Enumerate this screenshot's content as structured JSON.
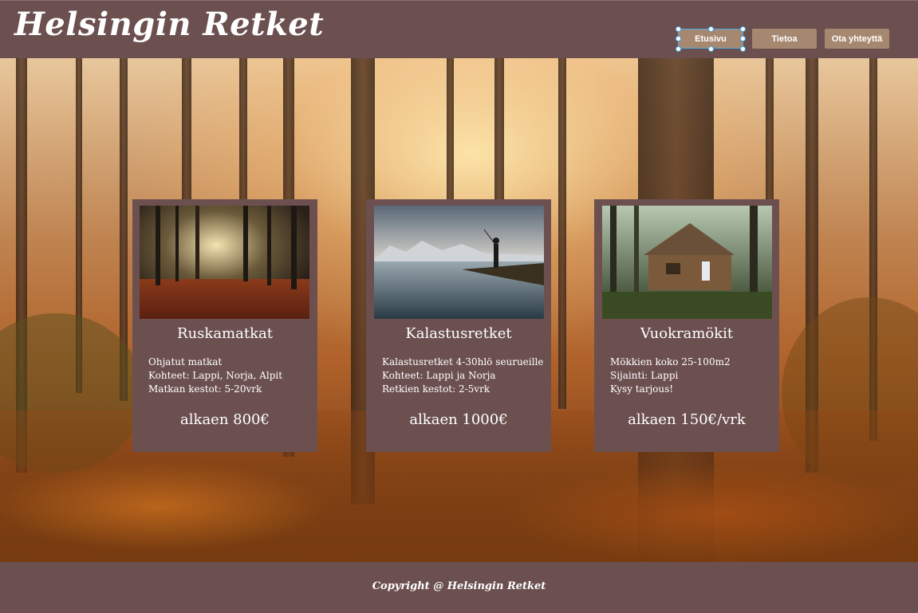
{
  "header": {
    "title": "Helsingin Retket",
    "nav": [
      {
        "label": "Etusivu",
        "active": true
      },
      {
        "label": "Tietoa",
        "active": false
      },
      {
        "label": "Ota yhteyttä",
        "active": false
      }
    ]
  },
  "cards": [
    {
      "title": "Ruskamatkat",
      "lines": [
        "Ohjatut matkat",
        "Kohteet: Lappi, Norja, Alpit",
        "Matkan kestot: 5-20vrk"
      ],
      "price": "alkaen 800€",
      "image": "autumn-forest-image"
    },
    {
      "title": "Kalastusretket",
      "lines": [
        "Kalastusretket 4-30hlö seurueille",
        "Kohteet: Lappi ja Norja",
        "Retkien kestot: 2-5vrk"
      ],
      "price": "alkaen 1000€",
      "image": "fishing-lake-image"
    },
    {
      "title": "Vuokramökit",
      "lines": [
        "Mökkien koko 25-100m2",
        "Sijainti: Lappi",
        "Kysy tarjous!"
      ],
      "price": "alkaen 150€/vrk",
      "image": "cabin-forest-image"
    }
  ],
  "footer": {
    "copyright": "Copyright @ Helsingin Retket"
  },
  "colors": {
    "panel": "#6c5050",
    "nav_button": "#a68871",
    "selection": "#4aa8e8"
  }
}
